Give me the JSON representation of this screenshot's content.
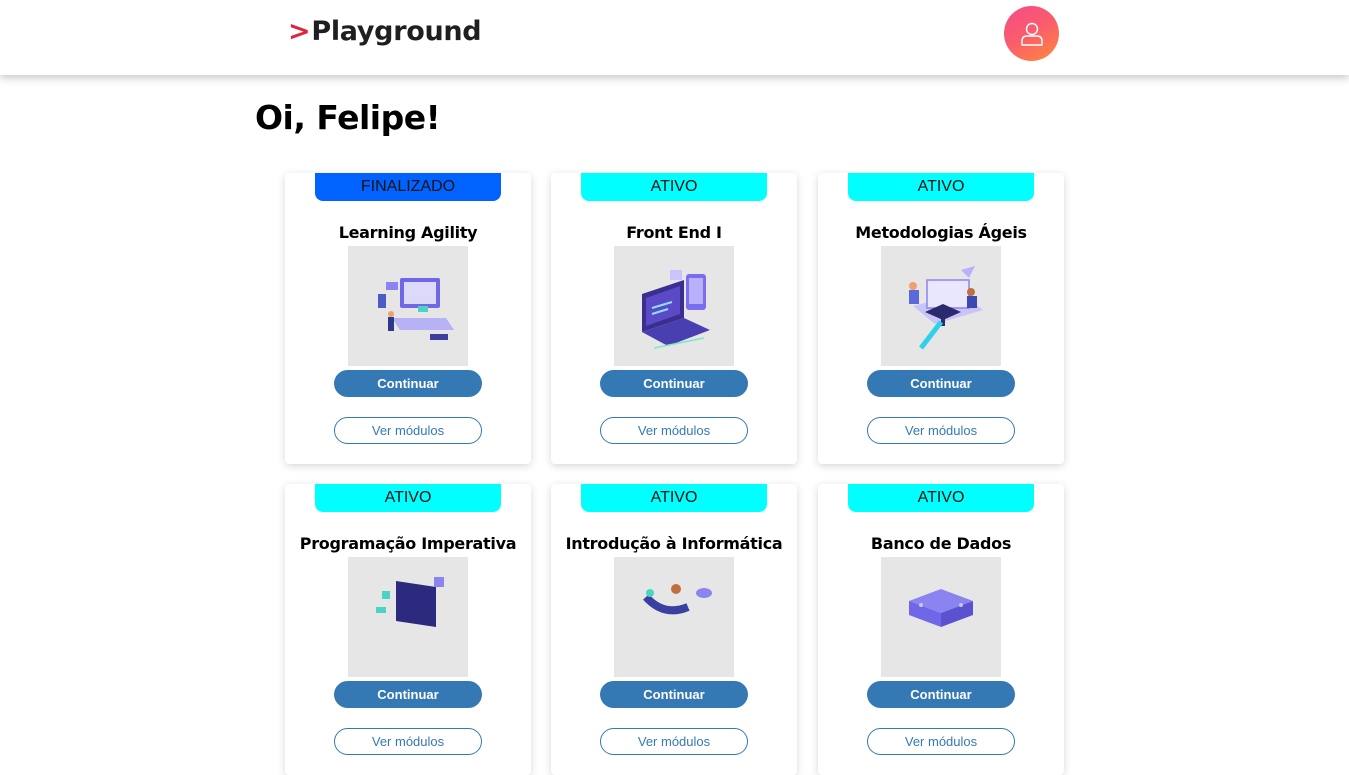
{
  "header": {
    "logo_chevron": ">",
    "logo_text": "Playground",
    "avatar_icon": "user-icon"
  },
  "greeting": "Oi, Felipe!",
  "colors": {
    "finalizado": "#0063ff",
    "ativo": "#00ffff",
    "primary_button": "#3579b4",
    "logo_accent": "#e0243d"
  },
  "courses": [
    {
      "status": "FINALIZADO",
      "title": "Learning Agility",
      "continue_label": "Continuar",
      "modules_label": "Ver módulos",
      "illustration": "computer-learning-illustration"
    },
    {
      "status": "ATIVO",
      "title": "Front End I",
      "continue_label": "Continuar",
      "modules_label": "Ver módulos",
      "illustration": "laptop-code-illustration"
    },
    {
      "status": "ATIVO",
      "title": "Metodologias Ágeis",
      "continue_label": "Continuar",
      "modules_label": "Ver módulos",
      "illustration": "graduation-study-illustration"
    },
    {
      "status": "ATIVO",
      "title": "Programação Imperativa",
      "continue_label": "Continuar",
      "modules_label": "Ver módulos",
      "illustration": "programming-illustration"
    },
    {
      "status": "ATIVO",
      "title": "Introdução à Informática",
      "continue_label": "Continuar",
      "modules_label": "Ver módulos",
      "illustration": "computing-intro-illustration"
    },
    {
      "status": "ATIVO",
      "title": "Banco de Dados",
      "continue_label": "Continuar",
      "modules_label": "Ver módulos",
      "illustration": "database-servers-illustration"
    }
  ]
}
